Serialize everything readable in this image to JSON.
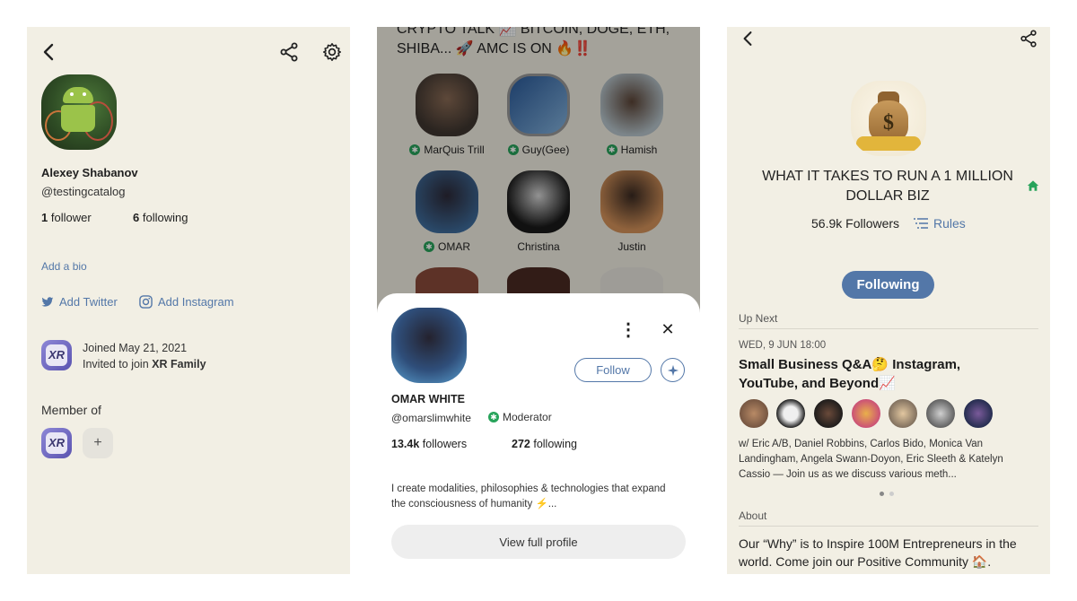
{
  "profile_panel": {
    "name": "Alexey Shabanov",
    "handle": "@testingcatalog",
    "followers_count": "1",
    "followers_label": "follower",
    "following_count": "6",
    "following_label": "following",
    "add_bio": "Add a bio",
    "add_twitter": "Add Twitter",
    "add_instagram": "Add Instagram",
    "joined": "Joined May 21, 2021",
    "invited_prefix": "Invited to join ",
    "invited_club": "XR Family",
    "member_of": "Member of",
    "club_logo_text": "XR",
    "add_club_symbol": "+"
  },
  "room_panel": {
    "room_title": "CRYPTO TALK 📈 BITCOIN, DOGE, ETH, SHIBA... 🚀 AMC IS ON 🔥‼️",
    "speakers": [
      {
        "name": "MarQuis Trill",
        "moderator": true
      },
      {
        "name": "Guy(Gee)",
        "moderator": true
      },
      {
        "name": "Hamish",
        "moderator": true
      },
      {
        "name": "OMAR",
        "moderator": true
      },
      {
        "name": "Christina",
        "moderator": false
      },
      {
        "name": "Justin",
        "moderator": false
      }
    ],
    "sheet": {
      "name": "OMAR WHITE",
      "handle": "@omarslimwhite",
      "role": "Moderator",
      "followers_count": "13.4k",
      "followers_label": "followers",
      "following_count": "272",
      "following_label": "following",
      "bio": "I create modalities, philosophies & technologies that expand the consciousness of humanity ⚡...",
      "follow_label": "Follow",
      "view_profile_label": "View full profile",
      "more_symbol": "⋮",
      "close_symbol": "✕"
    }
  },
  "club_panel": {
    "club_name": "WHAT IT TAKES TO RUN A 1 MILLION DOLLAR BIZ",
    "followers": "56.9k Followers",
    "rules_label": "Rules",
    "following_label": "Following",
    "up_next_label": "Up Next",
    "event_date": "WED, 9 JUN 18:00",
    "event_title": "Small Business Q&A🤔 Instagram, YouTube, and Beyond📈",
    "event_description": "w/ Eric A/B, Daniel Robbins, Carlos Bido, Monica Van Landingham, Angela Swann-Doyon, Eric Sleeth & Katelyn Cassio — Join us as we discuss various meth...",
    "about_label": "About",
    "about_text": "Our “Why” is to Inspire 100M Entrepreneurs in the world. Come join our Positive Community 🏠.",
    "bag_symbol": "$"
  },
  "colors": {
    "background": "#f2efe4",
    "accent": "#5377a8",
    "moderator_green": "#27a35a"
  },
  "icons": [
    "back-arrow-icon",
    "share-icon",
    "settings-gear-icon",
    "twitter-icon",
    "instagram-icon",
    "more-vertical-icon",
    "close-icon",
    "sparkle-icon",
    "house-icon",
    "rules-list-icon"
  ]
}
